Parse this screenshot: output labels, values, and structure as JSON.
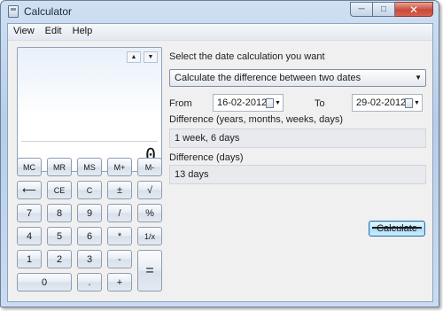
{
  "window": {
    "title": "Calculator",
    "icon": "calculator-icon"
  },
  "caption": {
    "minimize": "─",
    "maximize": "□",
    "close": "✕"
  },
  "menu": [
    "View",
    "Edit",
    "Help"
  ],
  "display": {
    "value": "0",
    "up": "▲",
    "down": "▼"
  },
  "keys": {
    "mc": "MC",
    "mr": "MR",
    "ms": "MS",
    "mplus": "M+",
    "mminus": "M-",
    "back": "⟵",
    "ce": "CE",
    "c": "C",
    "plusminus": "±",
    "sqrt": "√",
    "k7": "7",
    "k8": "8",
    "k9": "9",
    "div": "/",
    "pct": "%",
    "k4": "4",
    "k5": "5",
    "k6": "6",
    "mul": "*",
    "recip": "1/x",
    "k1": "1",
    "k2": "2",
    "k3": "3",
    "sub": "-",
    "eq": "=",
    "k0": "0",
    "dot": ".",
    "add": "+"
  },
  "date_calc": {
    "heading": "Select the date calculation you want",
    "mode": "Calculate the difference between two dates",
    "from_label": "From",
    "from_value": "16-02-2012",
    "to_label": "To",
    "to_value": "29-02-2012",
    "diff_label_1": "Difference (years, months, weeks, days)",
    "diff_value_1": "1 week, 6 days",
    "diff_label_2": "Difference (days)",
    "diff_value_2": "13 days",
    "calculate_label": "Calculate"
  }
}
